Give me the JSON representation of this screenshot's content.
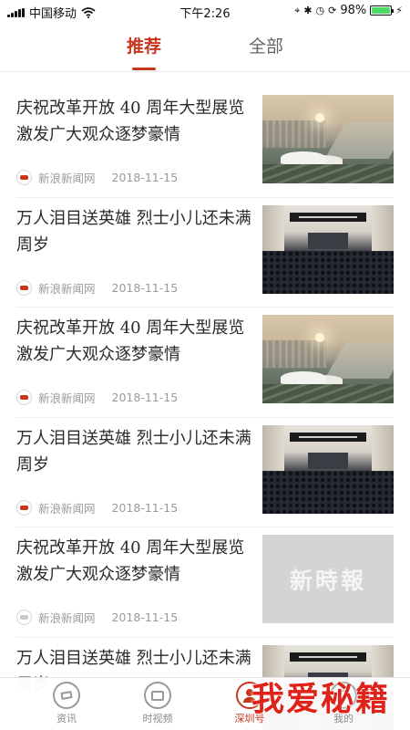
{
  "status_bar": {
    "carrier": "中国移动",
    "time": "下午2:26",
    "battery": "98%",
    "battery_level": 0.98,
    "battery_color": "#4cd964"
  },
  "tabs": [
    {
      "label": "推荐",
      "active": true
    },
    {
      "label": "全部",
      "active": false
    }
  ],
  "accent_color": "#c8361f",
  "news": [
    {
      "title": "庆祝改革开放 40 周年大型展览激发广大观众逐梦豪情",
      "source": "新浪新闻网",
      "date": "2018-11-15",
      "image": "city-skyline-image"
    },
    {
      "title": "万人泪目送英雄 烈士小儿还未满周岁",
      "source": "新浪新闻网",
      "date": "2018-11-15",
      "image": "meeting-hall-image"
    },
    {
      "title": "庆祝改革开放 40 周年大型展览激发广大观众逐梦豪情",
      "source": "新浪新闻网",
      "date": "2018-11-15",
      "image": "city-skyline-image"
    },
    {
      "title": "万人泪目送英雄 烈士小儿还未满周岁",
      "source": "新浪新闻网",
      "date": "2018-11-15",
      "image": "meeting-hall-image"
    },
    {
      "title": "庆祝改革开放 40 周年大型展览激发广大观众逐梦豪情",
      "source": "新浪新闻网",
      "date": "2018-11-15",
      "image": "newspaper-logo-image",
      "image_text": "新時報"
    },
    {
      "title": "万人泪目送英雄 烈士小儿还未满周岁",
      "source": "",
      "date": "",
      "image": "meeting-hall-image"
    }
  ],
  "bottom_nav": [
    {
      "label": "资讯",
      "icon": "news-icon",
      "active": false
    },
    {
      "label": "时视频",
      "icon": "video-icon",
      "active": false
    },
    {
      "label": "深圳号",
      "icon": "person-icon",
      "active": true
    },
    {
      "label": "我的",
      "icon": "profile-icon",
      "active": false
    }
  ],
  "watermark": "我爱秘籍"
}
